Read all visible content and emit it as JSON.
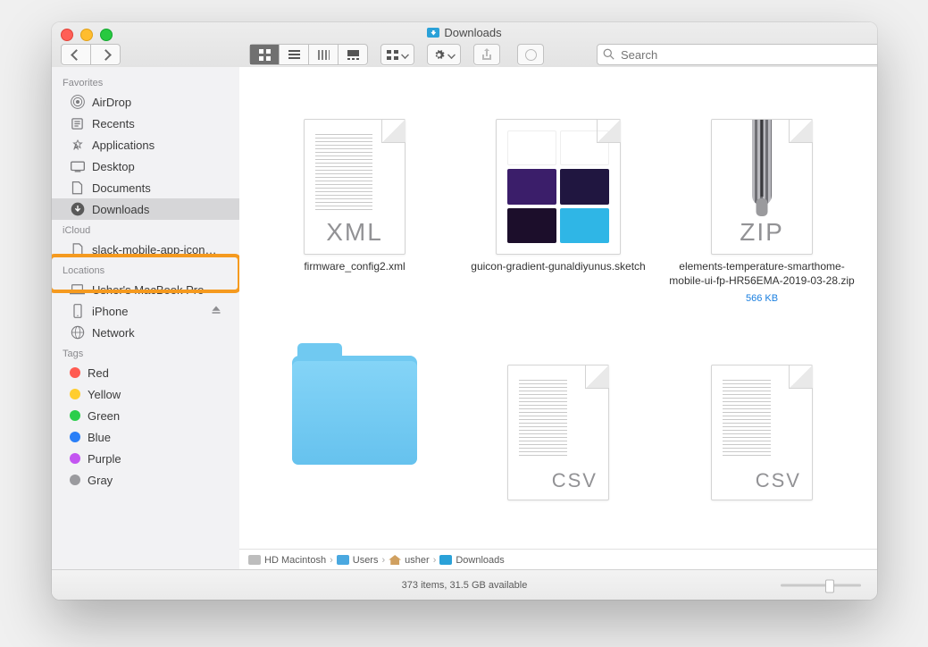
{
  "window_title": "Downloads",
  "toolbar": {
    "back_forward": "Back/Forward",
    "view": "View",
    "group": "Group",
    "action": "Action",
    "share": "Share",
    "edit_tags": "Edit Tags",
    "search_label": "Search",
    "search_placeholder": "Search"
  },
  "sidebar": {
    "favorites_head": "Favorites",
    "favorites": [
      {
        "label": "AirDrop",
        "icon": "airdrop"
      },
      {
        "label": "Recents",
        "icon": "recents"
      },
      {
        "label": "Applications",
        "icon": "apps"
      },
      {
        "label": "Desktop",
        "icon": "desktop"
      },
      {
        "label": "Documents",
        "icon": "docs"
      },
      {
        "label": "Downloads",
        "icon": "downloads"
      }
    ],
    "icloud_head": "iCloud",
    "icloud": [
      {
        "label": "slack-mobile-app-icon…",
        "icon": "file"
      }
    ],
    "locations_head": "Locations",
    "locations": [
      {
        "label": "Usher's MacBook Pro",
        "icon": "laptop"
      },
      {
        "label": "iPhone",
        "icon": "iphone",
        "eject": true
      },
      {
        "label": "Network",
        "icon": "network"
      }
    ],
    "tags_head": "Tags",
    "tags": [
      {
        "label": "Red",
        "color": "#ff5b51"
      },
      {
        "label": "Yellow",
        "color": "#ffcd2e"
      },
      {
        "label": "Green",
        "color": "#2cce4b"
      },
      {
        "label": "Blue",
        "color": "#2a7ff7"
      },
      {
        "label": "Purple",
        "color": "#c355f1"
      },
      {
        "label": "Gray",
        "color": "#9a9a9e"
      }
    ]
  },
  "files": {
    "row1": [
      {
        "name": "firmware_config2.xml",
        "kind": "xml"
      },
      {
        "name": "guicon-gradient-gunaldiyunus.sketch",
        "kind": "sketch"
      },
      {
        "name": "elements-temperature-smarthome-mobile-ui-fp-HR56EMA-2019-03-28.zip",
        "kind": "zip",
        "size": "566 KB"
      }
    ],
    "row2": [
      {
        "name": "",
        "kind": "folder"
      },
      {
        "name": "",
        "kind": "csv"
      },
      {
        "name": "",
        "kind": "csv"
      }
    ]
  },
  "pathbar": [
    "HD Macintosh",
    "Users",
    "usher",
    "Downloads"
  ],
  "status": "373 items, 31.5 GB available"
}
